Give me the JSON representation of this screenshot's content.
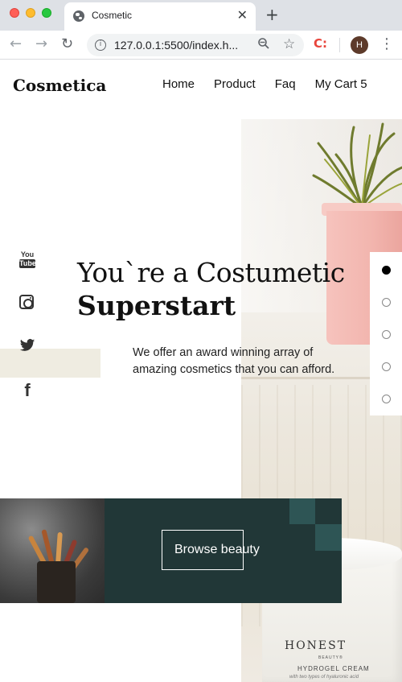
{
  "browser": {
    "tab_title": "Cosmetic",
    "tab_close": "✕",
    "new_tab": "+",
    "url": "127.0.0.1:5500/index.h...",
    "profile_initial": "H",
    "extension_label": "C:"
  },
  "header": {
    "logo": "Cosmetica",
    "nav": [
      "Home",
      "Product",
      "Faq",
      "My Cart 5"
    ]
  },
  "social": [
    "youtube-icon",
    "instagram-icon",
    "twitter-icon",
    "facebook-icon"
  ],
  "youtube_icon_text": {
    "top": "You",
    "bottom": "Tube"
  },
  "hero": {
    "title_line1": "You`re a Costumetic",
    "title_line2": "Superstart",
    "subtitle": "We offer an award winning array of amazing cosmetics that you can afford."
  },
  "slider": {
    "count": 5,
    "active_index": 0
  },
  "banner": {
    "button_label": "Browse beauty"
  },
  "product_jar": {
    "brand": "HONEST",
    "brand_sub": "BEAUTY®",
    "product": "HYDROGEL CREAM",
    "description": "with two types of hyaluronic acid"
  },
  "colors": {
    "banner_bg": "#213737",
    "banner_accent": "#2e5555",
    "beige_band": "#efece1"
  }
}
